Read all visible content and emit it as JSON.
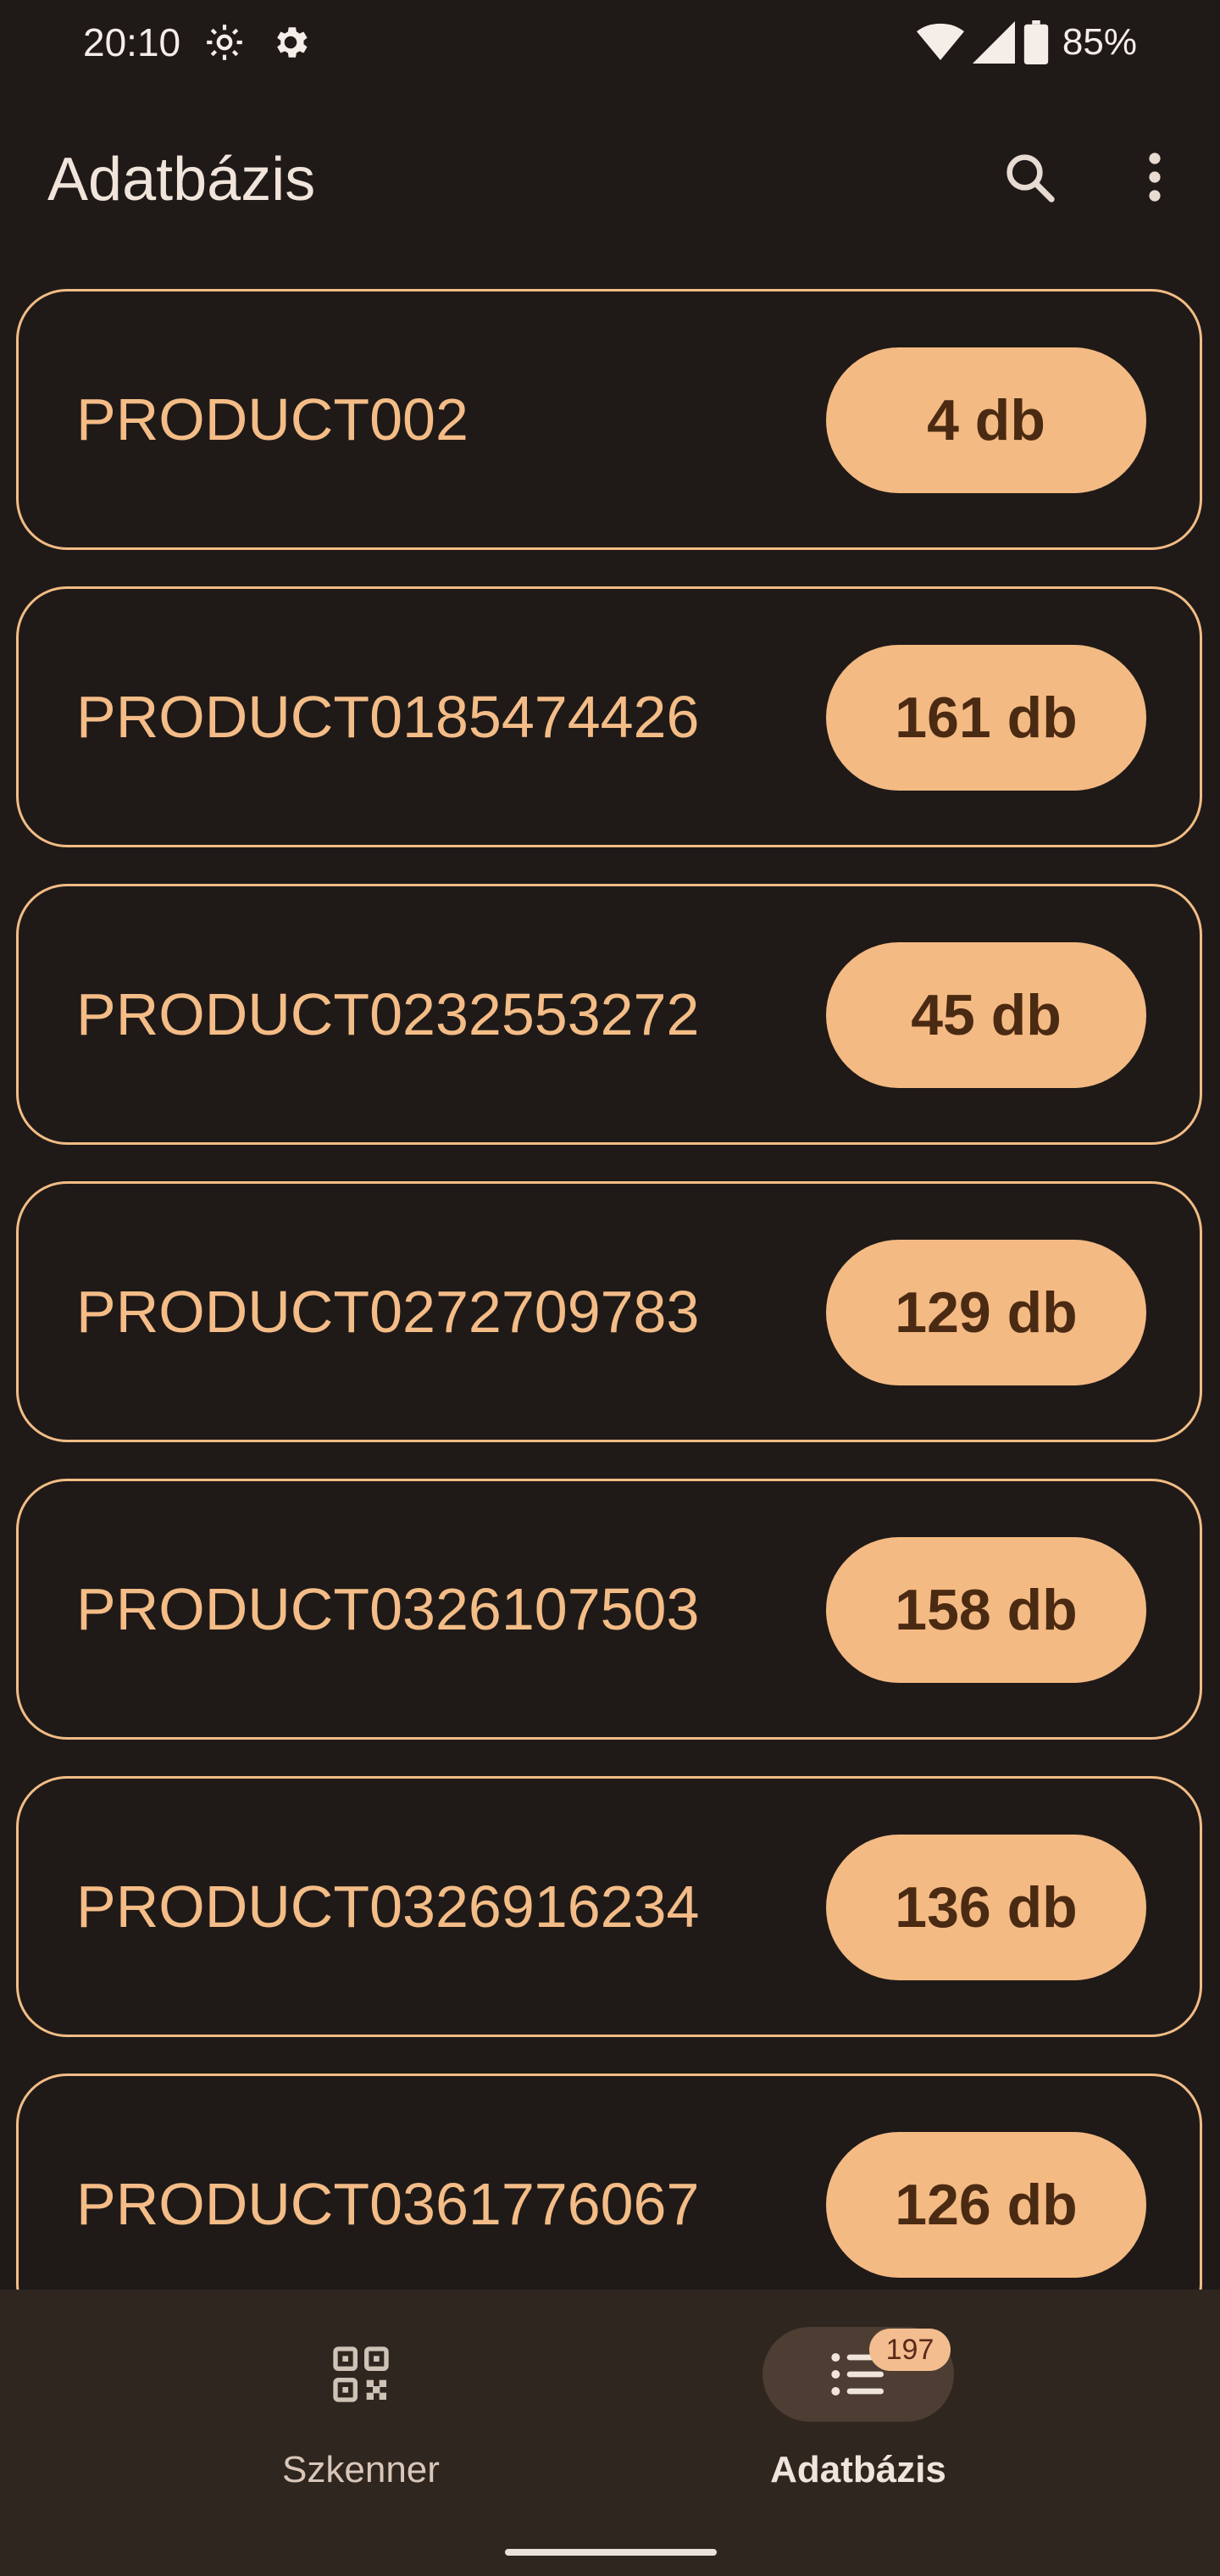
{
  "status_bar": {
    "time": "20:10",
    "battery": "85%"
  },
  "app_bar": {
    "title": "Adatbázis",
    "icons": [
      "search-icon",
      "more-vert-icon"
    ]
  },
  "products": [
    {
      "name": "PRODUCT002",
      "qty": "4 db"
    },
    {
      "name": "PRODUCT0185474426",
      "qty": "161 db"
    },
    {
      "name": "PRODUCT0232553272",
      "qty": "45 db"
    },
    {
      "name": "PRODUCT0272709783",
      "qty": "129 db"
    },
    {
      "name": "PRODUCT0326107503",
      "qty": "158 db"
    },
    {
      "name": "PRODUCT0326916234",
      "qty": "136 db"
    },
    {
      "name": "PRODUCT0361776067",
      "qty": "126 db"
    }
  ],
  "bottom_nav": {
    "items": [
      {
        "label": "Szkenner",
        "icon": "qr-scanner-icon",
        "active": false
      },
      {
        "label": "Adatbázis",
        "icon": "list-icon",
        "active": true,
        "badge": "197"
      }
    ]
  },
  "colors": {
    "background": "#1f1a18",
    "accent": "#f4ba83",
    "card_border": "#f2bc85",
    "nav_background": "#2f2620"
  }
}
